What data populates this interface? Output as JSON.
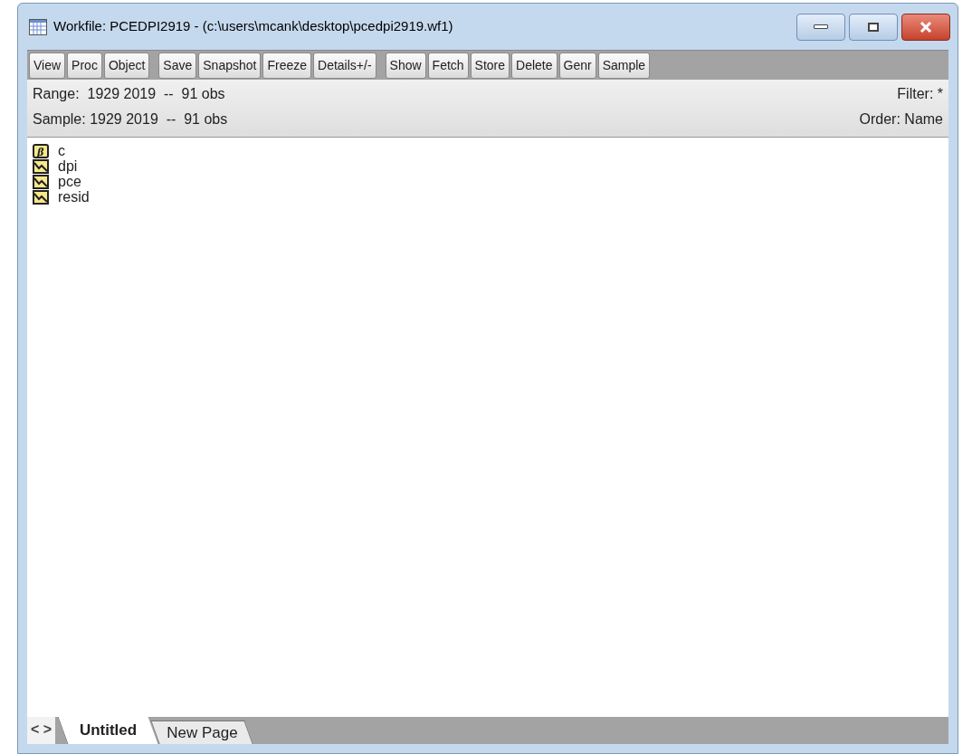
{
  "window": {
    "title": "Workfile: PCEDPI2919 - (c:\\users\\mcank\\desktop\\pcedpi2919.wf1)"
  },
  "toolbar": [
    [
      "View",
      "Proc",
      "Object"
    ],
    [
      "Save",
      "Snapshot",
      "Freeze",
      "Details+/-"
    ],
    [
      "Show",
      "Fetch",
      "Store",
      "Delete",
      "Genr",
      "Sample"
    ]
  ],
  "info": {
    "range": "Range:  1929 2019  --  91 obs",
    "sample": "Sample: 1929 2019  --  91 obs",
    "filter": "Filter: *",
    "order": "Order: Name"
  },
  "objects": [
    {
      "name": "c",
      "kind": "coef",
      "symbol": "β"
    },
    {
      "name": "dpi",
      "kind": "series"
    },
    {
      "name": "pce",
      "kind": "series"
    },
    {
      "name": "resid",
      "kind": "series"
    }
  ],
  "tab_nav": "< >",
  "tabs": [
    {
      "label": "Untitled",
      "selected": true
    },
    {
      "label": "New Page",
      "selected": false
    }
  ]
}
